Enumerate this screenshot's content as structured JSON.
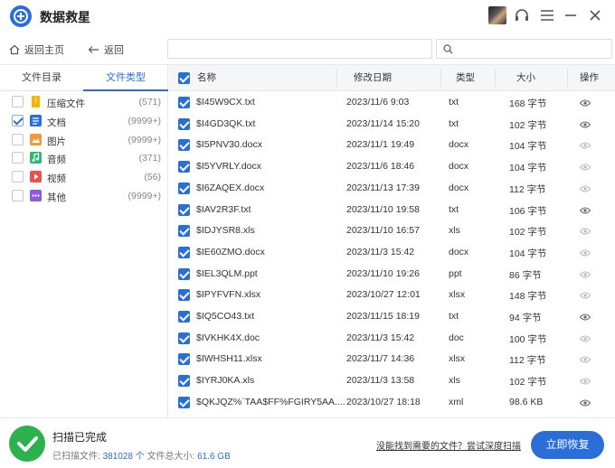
{
  "app": {
    "title": "数据救星"
  },
  "toolbar": {
    "home_label": "返回主页",
    "back_label": "返回",
    "path_value": "",
    "search_value": ""
  },
  "sidebar": {
    "tabs": [
      {
        "label": "文件目录",
        "active": false
      },
      {
        "label": "文件类型",
        "active": true
      }
    ],
    "categories": [
      {
        "label": "压缩文件",
        "count": "(571)",
        "checked": false,
        "icon": "archive-icon",
        "color": "#f5b400"
      },
      {
        "label": "文档",
        "count": "(9999+)",
        "checked": true,
        "icon": "document-icon",
        "color": "#2a6fd9"
      },
      {
        "label": "图片",
        "count": "(9999+)",
        "checked": false,
        "icon": "image-icon",
        "color": "#f29a38"
      },
      {
        "label": "音频",
        "count": "(371)",
        "checked": false,
        "icon": "audio-icon",
        "color": "#2fb872"
      },
      {
        "label": "视频",
        "count": "(56)",
        "checked": false,
        "icon": "video-icon",
        "color": "#e9534f"
      },
      {
        "label": "其他",
        "count": "(9999+)",
        "checked": false,
        "icon": "other-icon",
        "color": "#8e5bd8"
      }
    ]
  },
  "table": {
    "headers": {
      "name": "名称",
      "date": "修改日期",
      "type": "类型",
      "size": "大小",
      "action": "操作"
    },
    "rows": [
      {
        "name": "$I45W9CX.txt",
        "date": "2023/11/6 9:03",
        "type": "txt",
        "size": "168 字节",
        "eye_dark": true
      },
      {
        "name": "$I4GD3QK.txt",
        "date": "2023/11/14 15:20",
        "type": "txt",
        "size": "102 字节",
        "eye_dark": true
      },
      {
        "name": "$I5PNV30.docx",
        "date": "2023/11/1 19:49",
        "type": "docx",
        "size": "104 字节",
        "eye_dark": false
      },
      {
        "name": "$I5YVRLY.docx",
        "date": "2023/11/6 18:46",
        "type": "docx",
        "size": "104 字节",
        "eye_dark": false
      },
      {
        "name": "$I6ZAQEX.docx",
        "date": "2023/11/13 17:39",
        "type": "docx",
        "size": "112 字节",
        "eye_dark": false
      },
      {
        "name": "$IAV2R3F.txt",
        "date": "2023/11/10 19:58",
        "type": "txt",
        "size": "106 字节",
        "eye_dark": true
      },
      {
        "name": "$IDJYSR8.xls",
        "date": "2023/11/10 16:57",
        "type": "xls",
        "size": "102 字节",
        "eye_dark": false
      },
      {
        "name": "$IE60ZMO.docx",
        "date": "2023/11/3 15:42",
        "type": "docx",
        "size": "104 字节",
        "eye_dark": false
      },
      {
        "name": "$IEL3QLM.ppt",
        "date": "2023/11/10 19:26",
        "type": "ppt",
        "size": "86 字节",
        "eye_dark": false
      },
      {
        "name": "$IPYFVFN.xlsx",
        "date": "2023/10/27 12:01",
        "type": "xlsx",
        "size": "148 字节",
        "eye_dark": false
      },
      {
        "name": "$IQ5CO43.txt",
        "date": "2023/11/15 18:19",
        "type": "txt",
        "size": "94 字节",
        "eye_dark": true
      },
      {
        "name": "$IVKHK4X.doc",
        "date": "2023/11/3 15:42",
        "type": "doc",
        "size": "100 字节",
        "eye_dark": false
      },
      {
        "name": "$IWHSH11.xlsx",
        "date": "2023/11/7 14:36",
        "type": "xlsx",
        "size": "112 字节",
        "eye_dark": false
      },
      {
        "name": "$IYRJ0KA.xls",
        "date": "2023/11/3 13:58",
        "type": "xls",
        "size": "102 字节",
        "eye_dark": false
      },
      {
        "name": "$QKJQZ%`TAA$FF%FGIRY5AA....",
        "date": "2023/10/27 18:18",
        "type": "xml",
        "size": "98.6 KB",
        "eye_dark": true
      }
    ]
  },
  "footer": {
    "status_title": "扫描已完成",
    "scanned_label": "已扫描文件:",
    "scanned_count": "381028",
    "scanned_unit": "个",
    "total_label": "文件总大小:",
    "total_size": "61.6 GB",
    "deep_scan_link": "没能找到需要的文件？尝试深度扫描",
    "recover_button": "立即恢复"
  },
  "colors": {
    "accent": "#2a6fd9",
    "success": "#2bb24c"
  }
}
